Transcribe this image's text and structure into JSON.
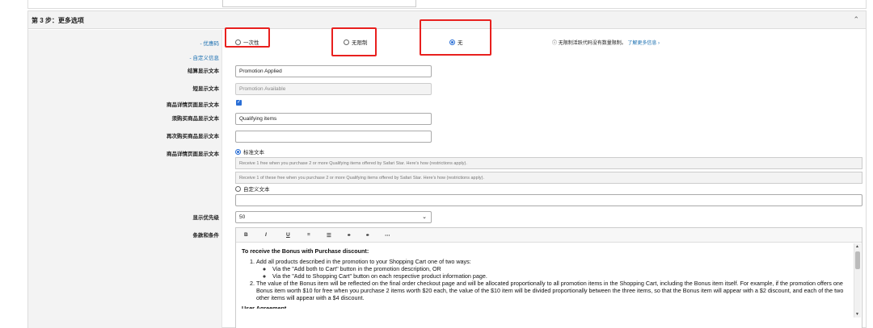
{
  "step": {
    "title": "第 3 步：更多选项"
  },
  "labels": {
    "discount_link": "- 优惠码",
    "custom_info_link": "- 自定义信息",
    "checkout_text": "结算显示文本",
    "short_text": "短显示文本",
    "detail_page_text": "商品详情页面显示文本",
    "purchase_text": "须购买商品显示文本",
    "again_text": "再次购买商品显示文本",
    "detail_desc_text": "商品详情页面显示文本",
    "priority": "显示优先级",
    "terms": "条款和条件"
  },
  "discount_options": [
    {
      "label": "一次性",
      "checked": false
    },
    {
      "label": "无限制",
      "checked": false
    },
    {
      "label": "无",
      "checked": true
    }
  ],
  "info": {
    "text": "无限制活跃代码没有数量限制。",
    "link": "了解更多信息 ›",
    "icon": "info-icon"
  },
  "fields": {
    "checkout_value": "Promotion Applied",
    "short_placeholder": "Promotion Available",
    "detail_checked": true,
    "purchase_value": "Qualifying items",
    "again_value": ""
  },
  "display_text": {
    "standard_label": "标准文本",
    "standard_line1": "Receive 1 free when you purchase 2 or more Qualifying items offered by Safari Star. Here's how (restrictions apply).",
    "standard_line2": "Receive 1 of these free when you purchase 2 or more Qualifying items offered by Safari Star. Here's how (restrictions apply).",
    "custom_label": "自定义文本",
    "custom_value": ""
  },
  "priority": {
    "value": "50"
  },
  "editor": {
    "toolbar": [
      "B",
      "I",
      "U",
      "≡",
      "☰",
      "⚭",
      "⚭",
      "⋯"
    ],
    "heading": "To receive the Bonus with Purchase discount:",
    "item1": "Add all products described in the promotion to your Shopping Cart one of two ways:",
    "sub1": "Via the \"Add both to Cart\" button in the promotion description, OR",
    "sub2": "Via the \"Add to Shopping Cart\" button on each respective product information page.",
    "item2": "The value of the Bonus item will be reflected on the final order checkout page and will be allocated proportionally to all promotion items in the Shopping Cart, including the Bonus item itself. For example, if the promotion offers one Bonus item worth $10 for free when you purchase 2 items worth $20 each, the value of the $10 item will be divided proportionally between the three items, so that the Bonus item will appear with a $2 discount, and each of the two other items will appear with a $4 discount.",
    "next": "User Agreement"
  },
  "colors": {
    "accent": "#2a6fd6",
    "highlight": "#e8201e",
    "link": "#1a6fb0"
  }
}
